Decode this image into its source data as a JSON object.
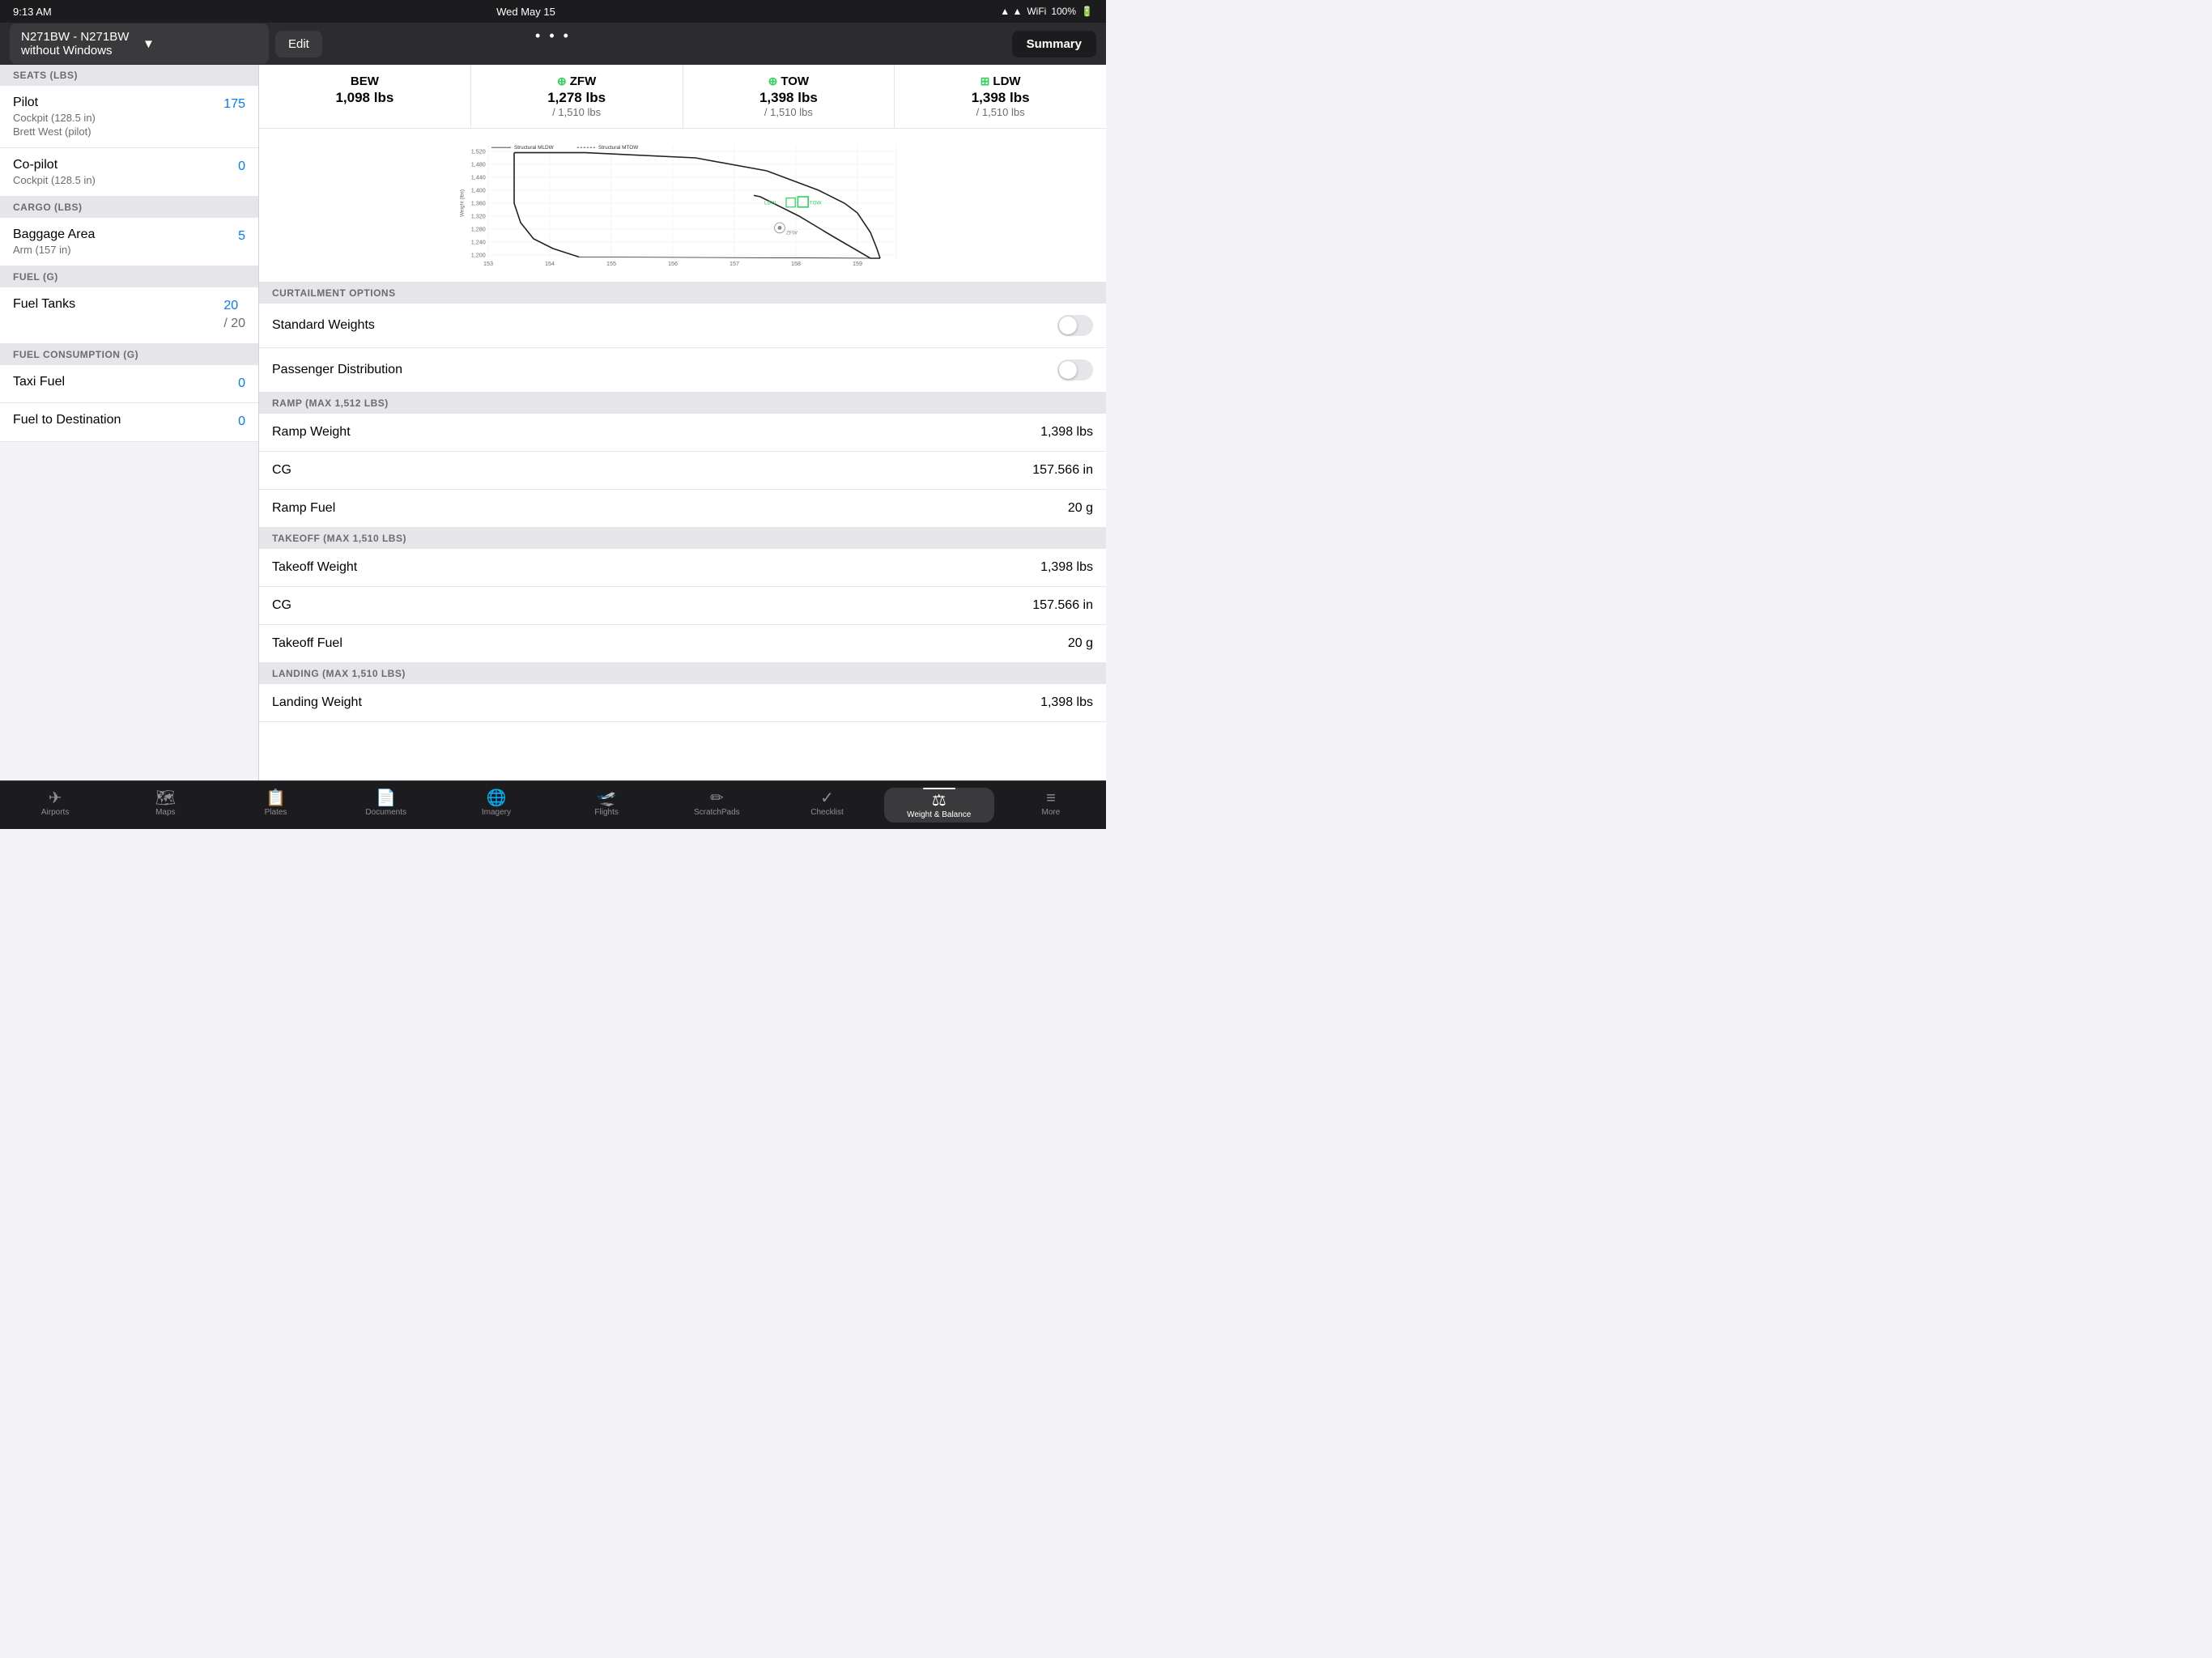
{
  "status_bar": {
    "time": "9:13 AM",
    "date": "Wed May 15",
    "battery": "100%",
    "signal": "▲"
  },
  "nav": {
    "aircraft_label": "N271BW - N271BW without Windows",
    "edit_button": "Edit",
    "summary_button": "Summary"
  },
  "left_panel": {
    "sections": [
      {
        "header": "SEATS (LBS)",
        "items": [
          {
            "title": "Pilot",
            "subtitle": "Cockpit (128.5 in)",
            "subtitle2": "Brett West (pilot)",
            "value": "175"
          },
          {
            "title": "Co-pilot",
            "subtitle": "Cockpit (128.5 in)",
            "subtitle2": "",
            "value": "0"
          }
        ]
      },
      {
        "header": "CARGO (LBS)",
        "items": [
          {
            "title": "Baggage Area",
            "subtitle": "Arm (157 in)",
            "subtitle2": "",
            "value": "5"
          }
        ]
      },
      {
        "header": "FUEL (G)",
        "items": [
          {
            "title": "Fuel Tanks",
            "subtitle": "",
            "subtitle2": "",
            "value": "20",
            "value2": "/ 20"
          }
        ]
      },
      {
        "header": "FUEL CONSUMPTION (G)",
        "items": [
          {
            "title": "Taxi Fuel",
            "subtitle": "",
            "subtitle2": "",
            "value": "0"
          },
          {
            "title": "Fuel to Destination",
            "subtitle": "",
            "subtitle2": "",
            "value": "0"
          }
        ]
      }
    ]
  },
  "weights": {
    "bew": {
      "label": "BEW",
      "value": "1,098 lbs",
      "max": ""
    },
    "zfw": {
      "label": "ZFW",
      "value": "1,278 lbs",
      "max": "/ 1,510 lbs"
    },
    "tow": {
      "label": "TOW",
      "value": "1,398 lbs",
      "max": "/ 1,510 lbs"
    },
    "ldw": {
      "label": "LDW",
      "value": "1,398 lbs",
      "max": "/ 1,510 lbs"
    }
  },
  "curtailment": {
    "header": "CURTAILMENT OPTIONS",
    "standard_weights": "Standard Weights",
    "passenger_distribution": "Passenger Distribution"
  },
  "ramp_section": {
    "header": "RAMP (MAX 1,512 LBS)",
    "ramp_weight_label": "Ramp Weight",
    "ramp_weight_value": "1,398 lbs",
    "cg_label": "CG",
    "cg_value": "157.566 in",
    "ramp_fuel_label": "Ramp Fuel",
    "ramp_fuel_value": "20 g"
  },
  "takeoff_section": {
    "header": "TAKEOFF (MAX 1,510 LBS)",
    "weight_label": "Takeoff Weight",
    "weight_value": "1,398 lbs",
    "cg_label": "CG",
    "cg_value": "157.566 in",
    "fuel_label": "Takeoff Fuel",
    "fuel_value": "20 g"
  },
  "landing_section": {
    "header": "LANDING (MAX 1,510 LBS)",
    "weight_label": "Landing Weight",
    "weight_value": "1,398 lbs"
  },
  "chart": {
    "x_labels": [
      "153",
      "154",
      "155",
      "156",
      "157",
      "158",
      "159"
    ],
    "y_labels": [
      "1,200",
      "1,240",
      "1,280",
      "1,320",
      "1,360",
      "1,400",
      "1,440",
      "1,480",
      "1,520"
    ],
    "annotations": [
      "Structural MLDW",
      "Structural MTOW"
    ]
  },
  "tab_bar": {
    "tabs": [
      {
        "id": "airports",
        "label": "Airports",
        "icon": "✈"
      },
      {
        "id": "maps",
        "label": "Maps",
        "icon": "🗺"
      },
      {
        "id": "plates",
        "label": "Plates",
        "icon": "📋"
      },
      {
        "id": "documents",
        "label": "Documents",
        "icon": "📄"
      },
      {
        "id": "imagery",
        "label": "Imagery",
        "icon": "🌐"
      },
      {
        "id": "flights",
        "label": "Flights",
        "icon": "🛫"
      },
      {
        "id": "scratchpads",
        "label": "ScratchPads",
        "icon": "✏"
      },
      {
        "id": "checklist",
        "label": "Checklist",
        "icon": "✓"
      },
      {
        "id": "weight-balance",
        "label": "Weight & Balance",
        "icon": "⚖"
      },
      {
        "id": "more",
        "label": "More",
        "icon": "≡"
      }
    ],
    "active": "weight-balance"
  }
}
